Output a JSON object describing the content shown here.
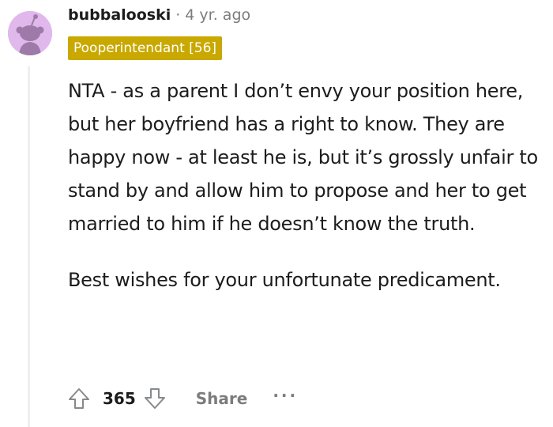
{
  "comment": {
    "username": "bubbalooski",
    "separator": "·",
    "age": "4 yr. ago",
    "flair": "Pooperintendant [56]",
    "flair_color": "#c9a800",
    "avatar_color": "#e0b8ec",
    "paragraphs": [
      "NTA - as a parent I don’t envy your position here, but her boyfriend has a right to know. They are happy now - at least he is, but it’s grossly unfair to stand by and allow him to propose and her to get married to him if he doesn’t know the truth.",
      "Best wishes for your unfortunate predicament."
    ]
  },
  "actions": {
    "upvote_icon": "upvote-arrow-icon",
    "score": "365",
    "downvote_icon": "downvote-arrow-icon",
    "share_label": "Share",
    "more_label": "···"
  }
}
